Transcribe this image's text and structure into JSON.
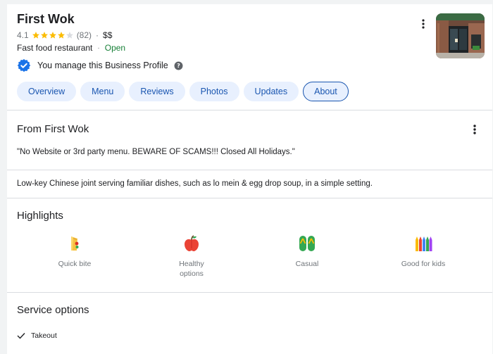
{
  "business": {
    "name": "First Wok",
    "rating": "4.1",
    "rating_value": 4.1,
    "review_count": "(82)",
    "separator": "·",
    "price": "$$",
    "category": "Fast food restaurant",
    "status_dot": "·",
    "status": "Open",
    "manage_text": "You manage this Business Profile"
  },
  "tabs": [
    "Overview",
    "Menu",
    "Reviews",
    "Photos",
    "Updates",
    "About"
  ],
  "active_tab": "About",
  "from_section": {
    "title": "From First Wok",
    "quote": "\"No Website or 3rd party menu. BEWARE OF SCAMS!!! Closed All Holidays.\""
  },
  "description": "Low-key Chinese joint serving familiar dishes, such as lo mein & egg drop soup, in a simple setting.",
  "highlights": {
    "title": "Highlights",
    "items": [
      {
        "label": "Quick bite",
        "icon": "sandwich-icon"
      },
      {
        "label_line1": "Healthy",
        "label_line2": "options",
        "icon": "apple-icon"
      },
      {
        "label": "Casual",
        "icon": "flip-flops-icon"
      },
      {
        "label": "Good for kids",
        "icon": "crayons-icon"
      }
    ]
  },
  "service_options": {
    "title": "Service options",
    "items": [
      "Takeout"
    ]
  },
  "colors": {
    "star": "#fbbc04",
    "open": "#188038",
    "tab_text": "#1a56b0",
    "tab_bg": "#e8f0fe",
    "verified": "#1a73e8"
  }
}
